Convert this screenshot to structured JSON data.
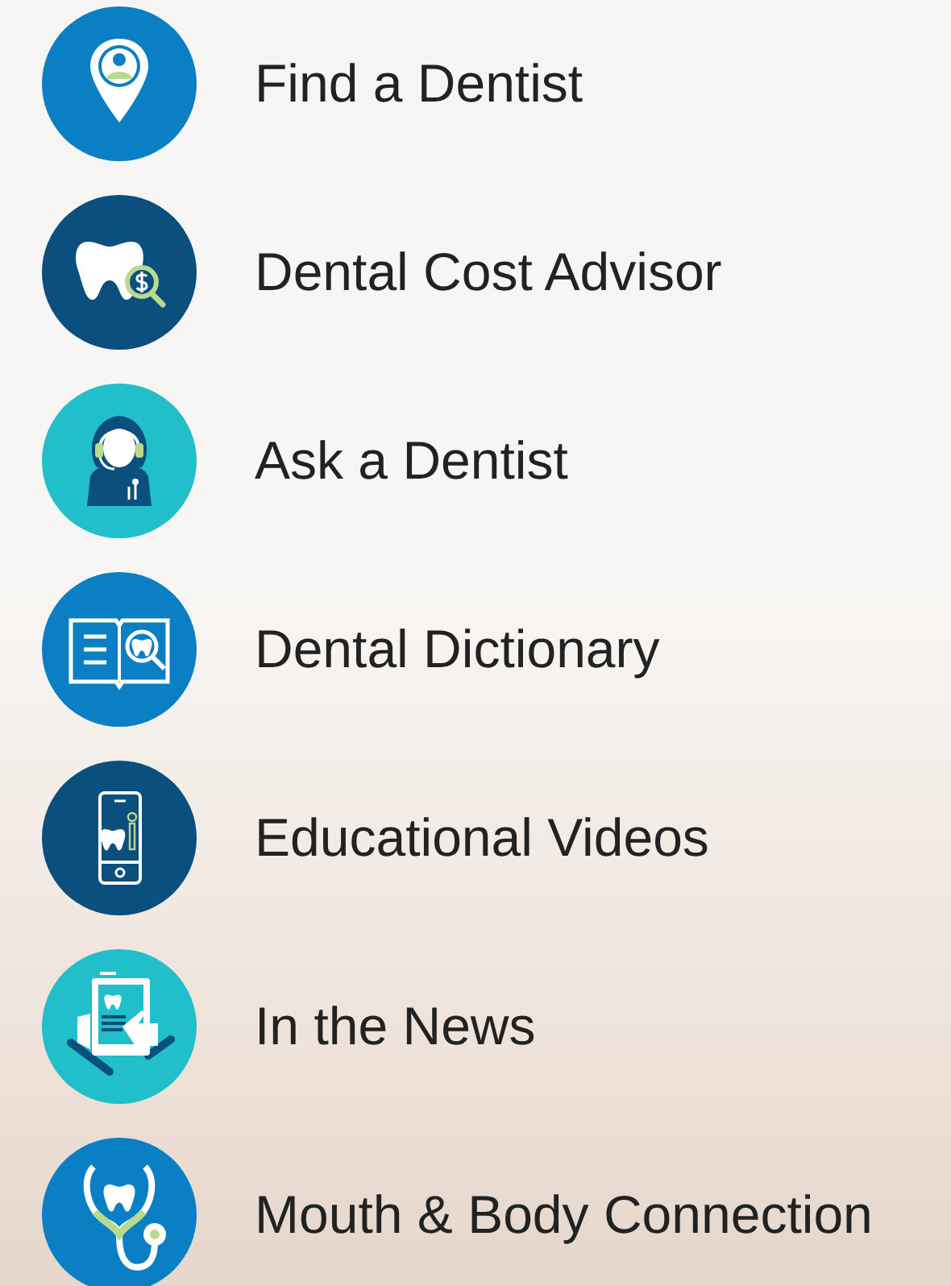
{
  "menu": [
    {
      "label": "Find a Dentist",
      "kind": "location",
      "color": "#0a7fc4"
    },
    {
      "label": "Dental Cost Advisor",
      "kind": "cost",
      "color": "#0b4f7e"
    },
    {
      "label": "Ask a Dentist",
      "kind": "support",
      "color": "#21bfc9"
    },
    {
      "label": "Dental Dictionary",
      "kind": "dictionary",
      "color": "#0a7fc4"
    },
    {
      "label": "Educational Videos",
      "kind": "video",
      "color": "#0b4f7e"
    },
    {
      "label": "In the News",
      "kind": "news",
      "color": "#21bfc9"
    },
    {
      "label": "Mouth & Body Connection",
      "kind": "stethoscope",
      "color": "#0a7fc4"
    }
  ]
}
